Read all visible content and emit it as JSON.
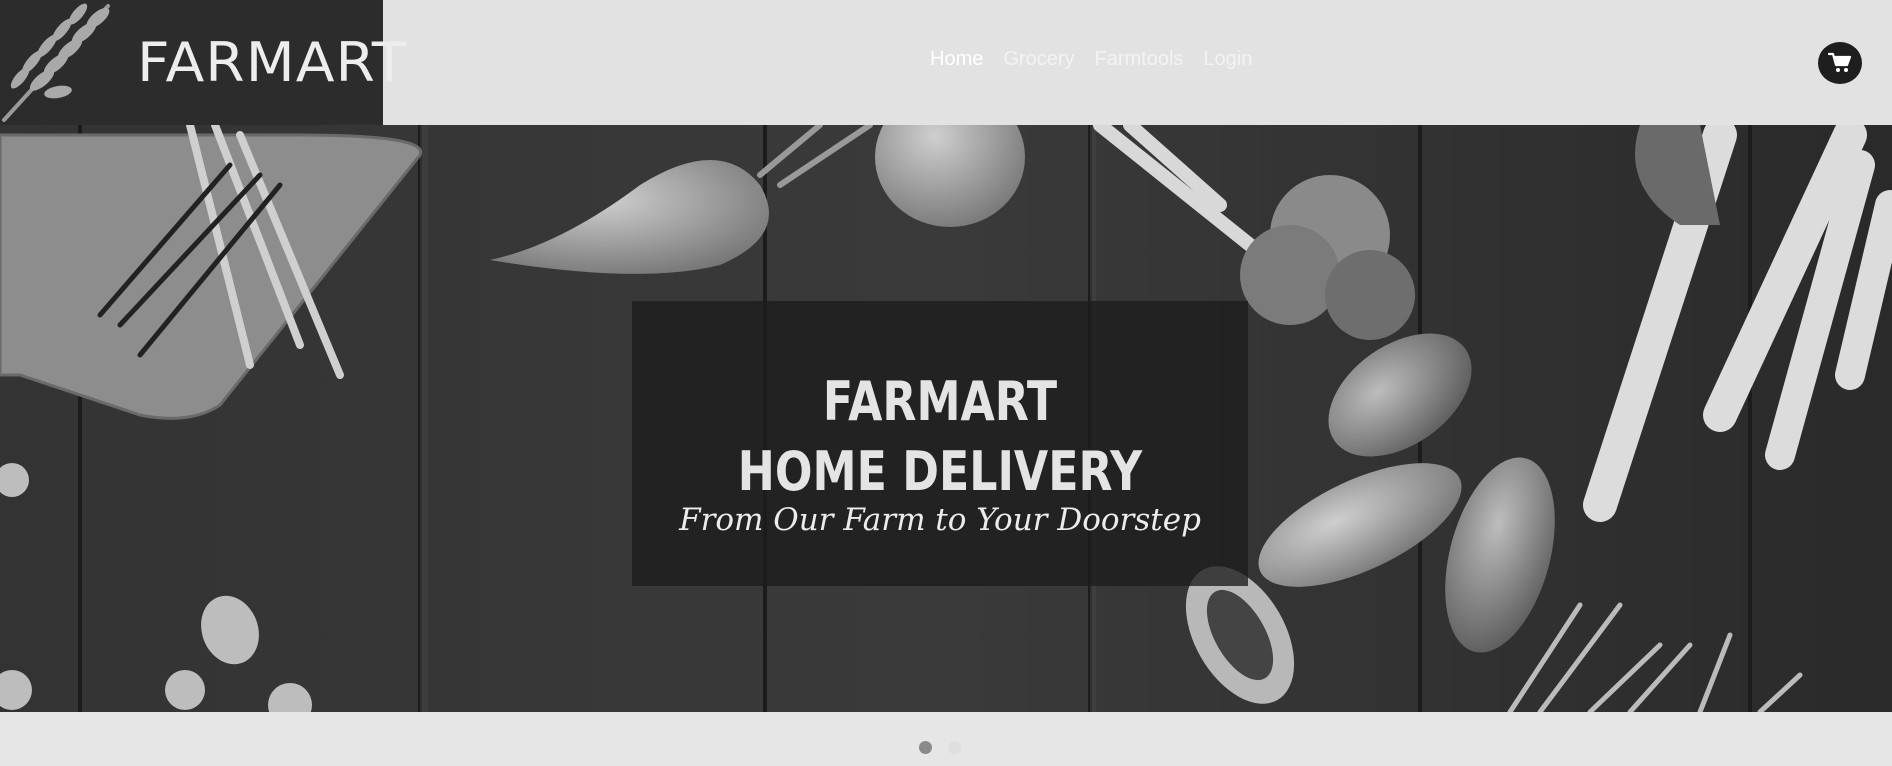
{
  "header": {
    "logo_text": "FARMART",
    "logo_icon": "wheat-icon",
    "nav": [
      {
        "label": "Home",
        "active": true
      },
      {
        "label": "Grocery",
        "active": false
      },
      {
        "label": "Farmtools",
        "active": false
      },
      {
        "label": "Login",
        "active": false
      }
    ],
    "cart_icon": "shopping-cart-icon"
  },
  "hero": {
    "title_line1": "FARMART",
    "title_line2": "HOME DELIVERY",
    "tagline": "From Our Farm to Your Doorstep",
    "background": "vegetables-on-wooden-table"
  },
  "carousel": {
    "slide_count": 2,
    "active_index": 0
  },
  "colors": {
    "header_bg": "#e2e2e2",
    "logo_bg": "#2c2c2c",
    "panel_bg": "#1c1c1c",
    "dot_active": "#8a8a8a"
  }
}
